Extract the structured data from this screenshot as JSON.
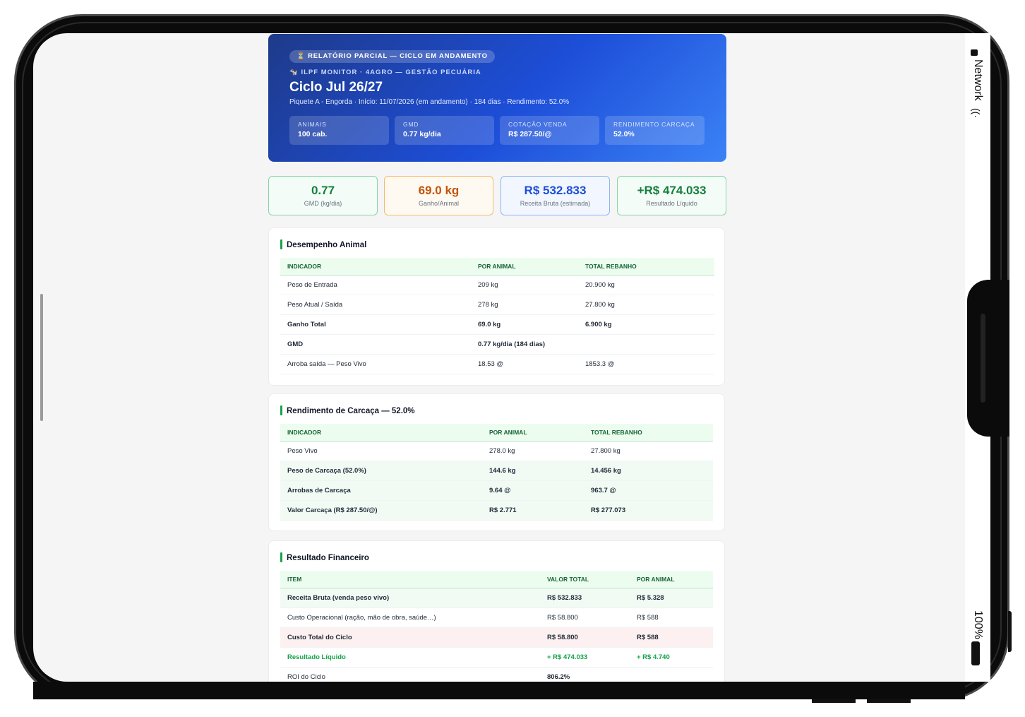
{
  "status": {
    "network": "Network",
    "battery": "100%"
  },
  "hero": {
    "badge": "⏳ RELATÓRIO PARCIAL — CICLO EM ANDAMENTO",
    "subtitle": "🐄 ILPF MONITOR · 4AGRO — GESTÃO PECUÁRIA",
    "title": "Ciclo Jul 26/27",
    "meta": "Piquete A - Engorda · Início: 11/07/2026 (em andamento) · 184 dias · Rendimento: 52.0%",
    "cards": [
      {
        "label": "ANIMAIS",
        "value": "100 cab."
      },
      {
        "label": "GMD",
        "value": "0.77 kg/dia"
      },
      {
        "label": "COTAÇÃO VENDA",
        "value": "R$ 287.50/@"
      },
      {
        "label": "RENDIMENTO CARCAÇA",
        "value": "52.0%"
      }
    ]
  },
  "kpis": [
    {
      "value": "0.77",
      "label": "GMD (kg/dia)"
    },
    {
      "value": "69.0 kg",
      "label": "Ganho/Animal"
    },
    {
      "value": "R$ 532.833",
      "label": "Receita Bruta (estimada)"
    },
    {
      "value": "+R$ 474.033",
      "label": "Resultado Líquido"
    }
  ],
  "desempenho": {
    "title": "Desempenho Animal",
    "headers": [
      "INDICADOR",
      "POR ANIMAL",
      "TOTAL REBANHO"
    ],
    "rows": [
      [
        "Peso de Entrada",
        "209 kg",
        "20.900 kg"
      ],
      [
        "Peso Atual / Saída",
        "278 kg",
        "27.800 kg"
      ],
      [
        "Ganho Total",
        "69.0 kg",
        "6.900 kg"
      ],
      [
        "GMD",
        "0.77 kg/dia (184 dias)",
        ""
      ],
      [
        "Arroba saída — Peso Vivo",
        "18.53 @",
        "1853.3 @"
      ]
    ]
  },
  "carcaca": {
    "title": "Rendimento de Carcaça — 52.0%",
    "headers": [
      "INDICADOR",
      "POR ANIMAL",
      "TOTAL REBANHO"
    ],
    "rows": [
      [
        "Peso Vivo",
        "278.0 kg",
        "27.800 kg"
      ],
      [
        "Peso de Carcaça (52.0%)",
        "144.6 kg",
        "14.456 kg"
      ],
      [
        "Arrobas de Carcaça",
        "9.64 @",
        "963.7 @"
      ],
      [
        "Valor Carcaça (R$ 287.50/@)",
        "R$ 2.771",
        "R$ 277.073"
      ]
    ]
  },
  "financeiro": {
    "title": "Resultado Financeiro",
    "headers": [
      "ITEM",
      "VALOR TOTAL",
      "POR ANIMAL"
    ],
    "rows": [
      [
        "Receita Bruta (venda peso vivo)",
        "R$ 532.833",
        "R$ 5.328"
      ],
      [
        "Custo Operacional (ração, mão de obra, saúde…)",
        "R$ 58.800",
        "R$ 588"
      ],
      [
        "Custo Total do Ciclo",
        "R$ 58.800",
        "R$ 588"
      ],
      [
        "Resultado Líquido",
        "+ R$ 474.033",
        "+ R$ 4.740"
      ],
      [
        "ROI do Ciclo",
        "806.2%",
        ""
      ]
    ]
  }
}
